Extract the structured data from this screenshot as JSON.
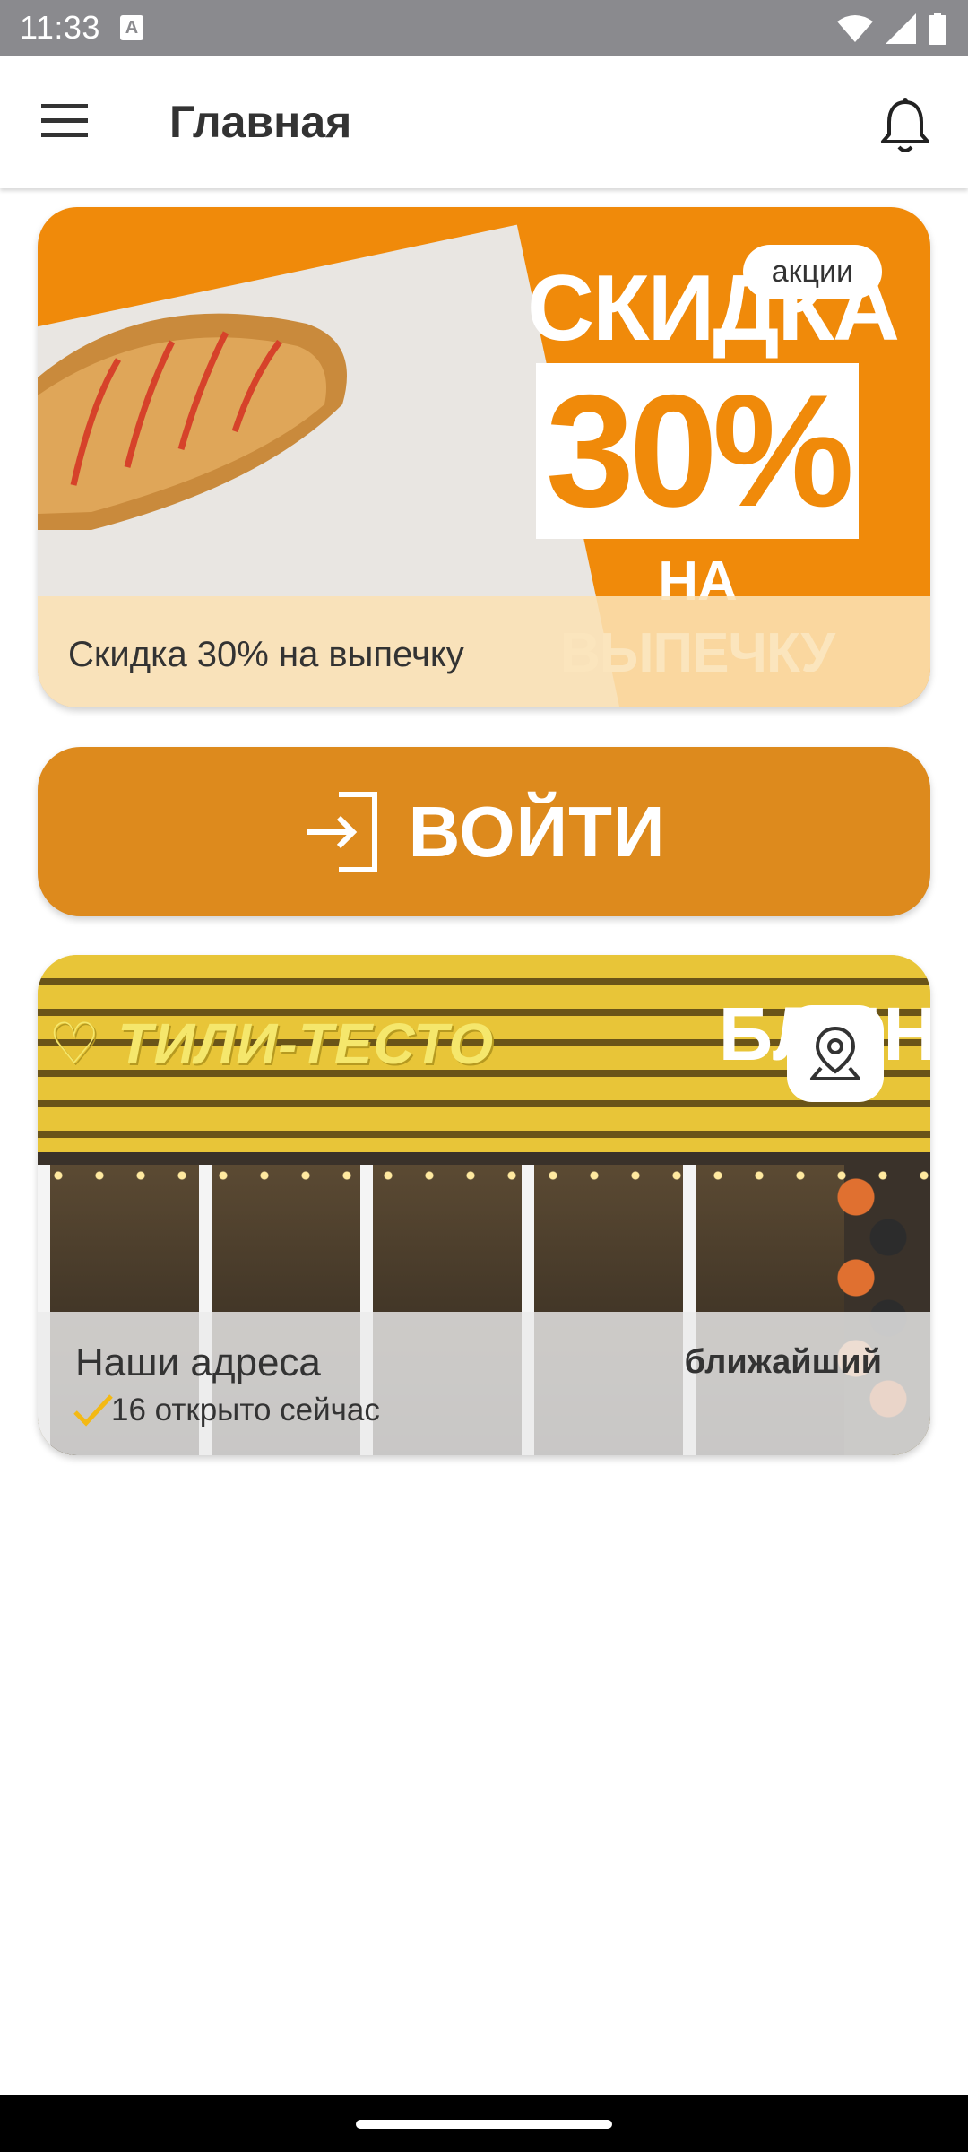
{
  "status_bar": {
    "time": "11:33",
    "notification_letter": "A"
  },
  "app_bar": {
    "title": "Главная"
  },
  "promo": {
    "line1": "СКИДКА",
    "line2": "30%",
    "line3": "НА ВЫПЕЧКУ",
    "chip": "акции",
    "caption": "Скидка 30% на выпечку"
  },
  "login": {
    "label": "ВОЙТИ"
  },
  "addresses": {
    "sign_left": "♡ ТИЛИ-ТЕСТО",
    "sign_right": "БЛИН",
    "title": "Наши адреса",
    "open_now": "16 открыто сейчас",
    "nearest": "ближайший"
  },
  "colors": {
    "accent_orange": "#f08a0a",
    "login_orange": "#dd8a1d",
    "check_yellow": "#f3b914"
  },
  "icons": [
    "menu-icon",
    "bell-icon",
    "login-icon",
    "map-pin-icon",
    "check-icon",
    "wifi-icon",
    "signal-icon",
    "battery-icon"
  ]
}
